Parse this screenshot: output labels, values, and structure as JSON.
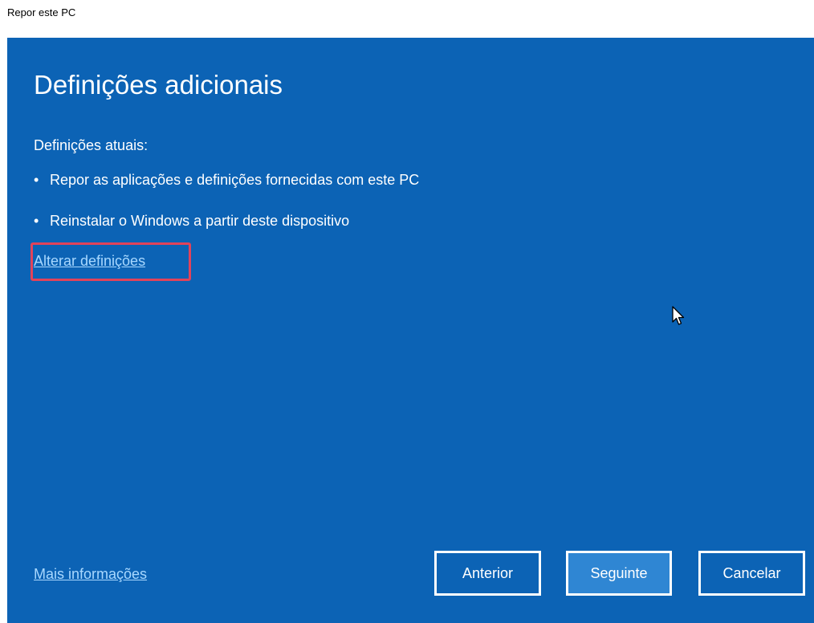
{
  "window": {
    "title": "Repor este PC"
  },
  "page": {
    "heading": "Definições adicionais",
    "current_settings_label": "Definições atuais:",
    "bullets": [
      "Repor as aplicações e definições fornecidas com este PC",
      "Reinstalar o Windows a partir deste dispositivo"
    ],
    "bullet_marker": "•",
    "change_settings_link": "Alterar definições",
    "more_info_link": "Mais informações"
  },
  "buttons": {
    "previous": "Anterior",
    "next": "Seguinte",
    "cancel": "Cancelar"
  },
  "colors": {
    "panel_background": "#0c63b5",
    "primary_button": "#2f86d3",
    "link": "#a8d8ff",
    "highlight_border": "#e2435a"
  },
  "icons": {
    "mouse_cursor": "arrow-cursor-icon"
  }
}
